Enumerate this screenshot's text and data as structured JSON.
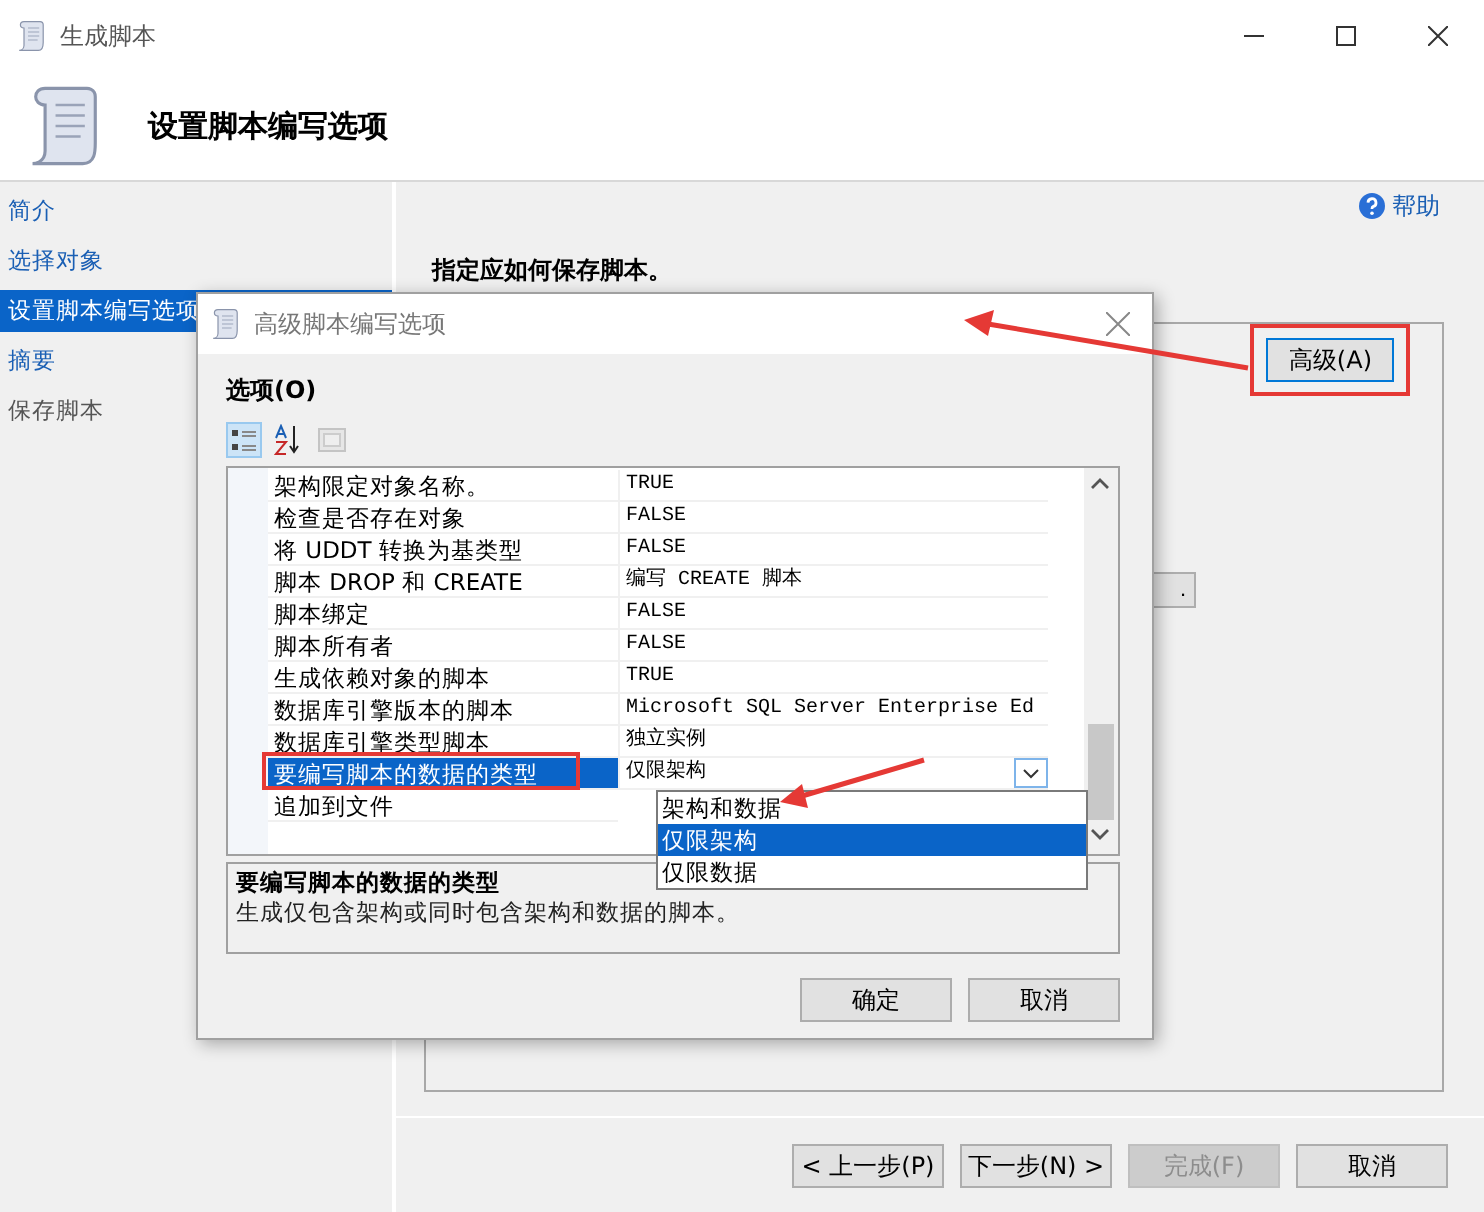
{
  "window": {
    "title": "生成脚本"
  },
  "header": {
    "title": "设置脚本编写选项"
  },
  "sidebar": {
    "items": [
      {
        "label": "简介",
        "selected": false,
        "disabled": false
      },
      {
        "label": "选择对象",
        "selected": false,
        "disabled": false
      },
      {
        "label": "设置脚本编写选项",
        "selected": true,
        "disabled": false
      },
      {
        "label": "摘要",
        "selected": false,
        "disabled": false
      },
      {
        "label": "保存脚本",
        "selected": false,
        "disabled": true
      }
    ]
  },
  "main": {
    "help": "帮助",
    "instruction": "指定应如何保存脚本。",
    "advanced_button": {
      "label": "高级(A)",
      "highlighted": true
    },
    "partial_button": {
      "label": "."
    }
  },
  "wizard_buttons": [
    {
      "label": "< 上一步(P)",
      "disabled": false
    },
    {
      "label": "下一步(N) >",
      "disabled": false
    },
    {
      "label": "完成(F)",
      "disabled": true
    },
    {
      "label": "取消",
      "disabled": false
    }
  ],
  "dialog": {
    "title": "高级脚本编写选项",
    "options_label": "选项(O)",
    "toolbar": [
      {
        "kind": "categorized",
        "selected": true,
        "disabled": false
      },
      {
        "kind": "alphabetical",
        "selected": false,
        "disabled": false
      },
      {
        "kind": "property-pages",
        "selected": false,
        "disabled": true
      }
    ],
    "properties": [
      {
        "name": "架构限定对象名称。",
        "value": "TRUE",
        "selected": false,
        "highlighted": false
      },
      {
        "name": "检查是否存在对象",
        "value": "FALSE",
        "selected": false,
        "highlighted": false
      },
      {
        "name": "将 UDDT 转换为基类型",
        "value": "FALSE",
        "selected": false,
        "highlighted": false
      },
      {
        "name": "脚本 DROP 和 CREATE",
        "value": "编写 CREATE 脚本",
        "selected": false,
        "highlighted": false
      },
      {
        "name": "脚本绑定",
        "value": "FALSE",
        "selected": false,
        "highlighted": false
      },
      {
        "name": "脚本所有者",
        "value": "FALSE",
        "selected": false,
        "highlighted": false
      },
      {
        "name": "生成依赖对象的脚本",
        "value": "TRUE",
        "selected": false,
        "highlighted": false
      },
      {
        "name": "数据库引擎版本的脚本",
        "value": "Microsoft SQL Server Enterprise Ed",
        "selected": false,
        "highlighted": false
      },
      {
        "name": "数据库引擎类型脚本",
        "value": "独立实例",
        "selected": false,
        "highlighted": false
      },
      {
        "name": "要编写脚本的数据的类型",
        "value": "仅限架构",
        "selected": true,
        "highlighted": true
      },
      {
        "name": "追加到文件",
        "selected": false,
        "highlighted": false
      }
    ],
    "dropdown": {
      "options": [
        {
          "label": "架构和数据",
          "selected": false
        },
        {
          "label": "仅限架构",
          "selected": true
        },
        {
          "label": "仅限数据",
          "selected": false
        }
      ]
    },
    "description": {
      "title": "要编写脚本的数据的类型",
      "text": "生成仅包含架构或同时包含架构和数据的脚本。"
    },
    "buttons": [
      "确定",
      "取消"
    ]
  }
}
